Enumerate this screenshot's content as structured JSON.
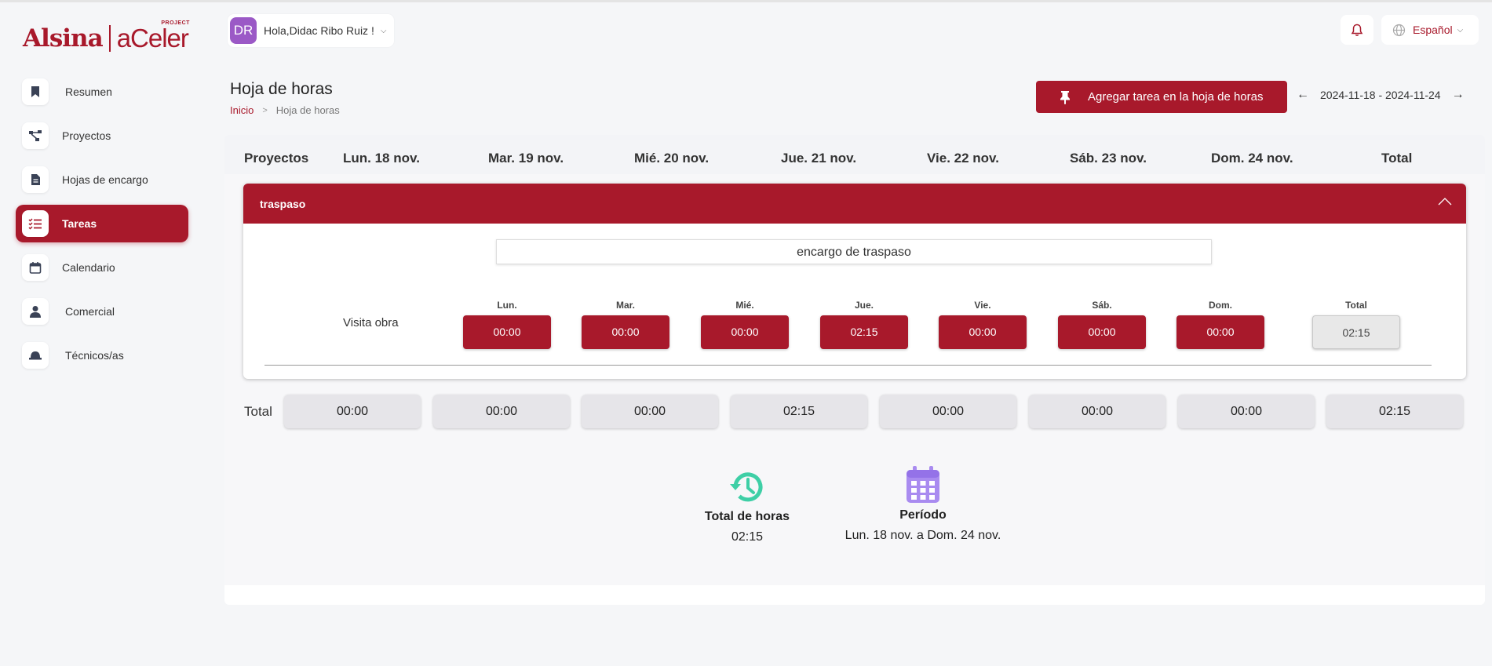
{
  "brand": {
    "name": "Alsina",
    "product": "aCeler",
    "tag": "PROJECT"
  },
  "user": {
    "initials": "DR",
    "greeting": "Hola,Didac Ribo Ruiz !"
  },
  "language": "Español",
  "sidebar": {
    "items": [
      {
        "label": "Resumen",
        "icon": "bookmark-icon"
      },
      {
        "label": "Proyectos",
        "icon": "share-nodes-icon"
      },
      {
        "label": "Hojas de encargo",
        "icon": "document-icon"
      },
      {
        "label": "Tareas",
        "icon": "task-list-icon"
      },
      {
        "label": "Calendario",
        "icon": "calendar-icon"
      },
      {
        "label": "Comercial",
        "icon": "user-icon"
      },
      {
        "label": "Técnicos/as",
        "icon": "helmet-icon"
      }
    ]
  },
  "page": {
    "title": "Hoja de horas",
    "breadcrumb": {
      "home": "Inicio",
      "current": "Hoja de horas"
    }
  },
  "toolbar": {
    "add_task_label": "Agregar tarea en la hoja de horas",
    "week_range": "2024-11-18 - 2024-11-24"
  },
  "table": {
    "headers": [
      "Proyectos",
      "Lun. 18 nov.",
      "Mar. 19 nov.",
      "Mié. 20 nov.",
      "Jue. 21 nov.",
      "Vie. 22 nov.",
      "Sáb. 23 nov.",
      "Dom. 24 nov.",
      "Total"
    ]
  },
  "project": {
    "name": "traspaso",
    "order": "encargo de traspaso",
    "task": {
      "name": "Visita obra",
      "day_labels": [
        "Lun.",
        "Mar.",
        "Mié.",
        "Jue.",
        "Vie.",
        "Sáb.",
        "Dom.",
        "Total"
      ],
      "values": [
        "00:00",
        "00:00",
        "00:00",
        "02:15",
        "00:00",
        "00:00",
        "00:00",
        "02:15"
      ]
    }
  },
  "totals": {
    "label": "Total",
    "values": [
      "00:00",
      "00:00",
      "00:00",
      "02:15",
      "00:00",
      "00:00",
      "00:00",
      "02:15"
    ]
  },
  "summary": {
    "hours_label": "Total de horas",
    "hours_value": "02:15",
    "period_label": "Período",
    "period_value": "Lun. 18 nov. a Dom. 24 nov."
  },
  "colors": {
    "primary": "#a8192b",
    "avatar": "#9b59c6",
    "history_icon": "#3ecfa6",
    "calendar_icon": "#a98bf0"
  }
}
